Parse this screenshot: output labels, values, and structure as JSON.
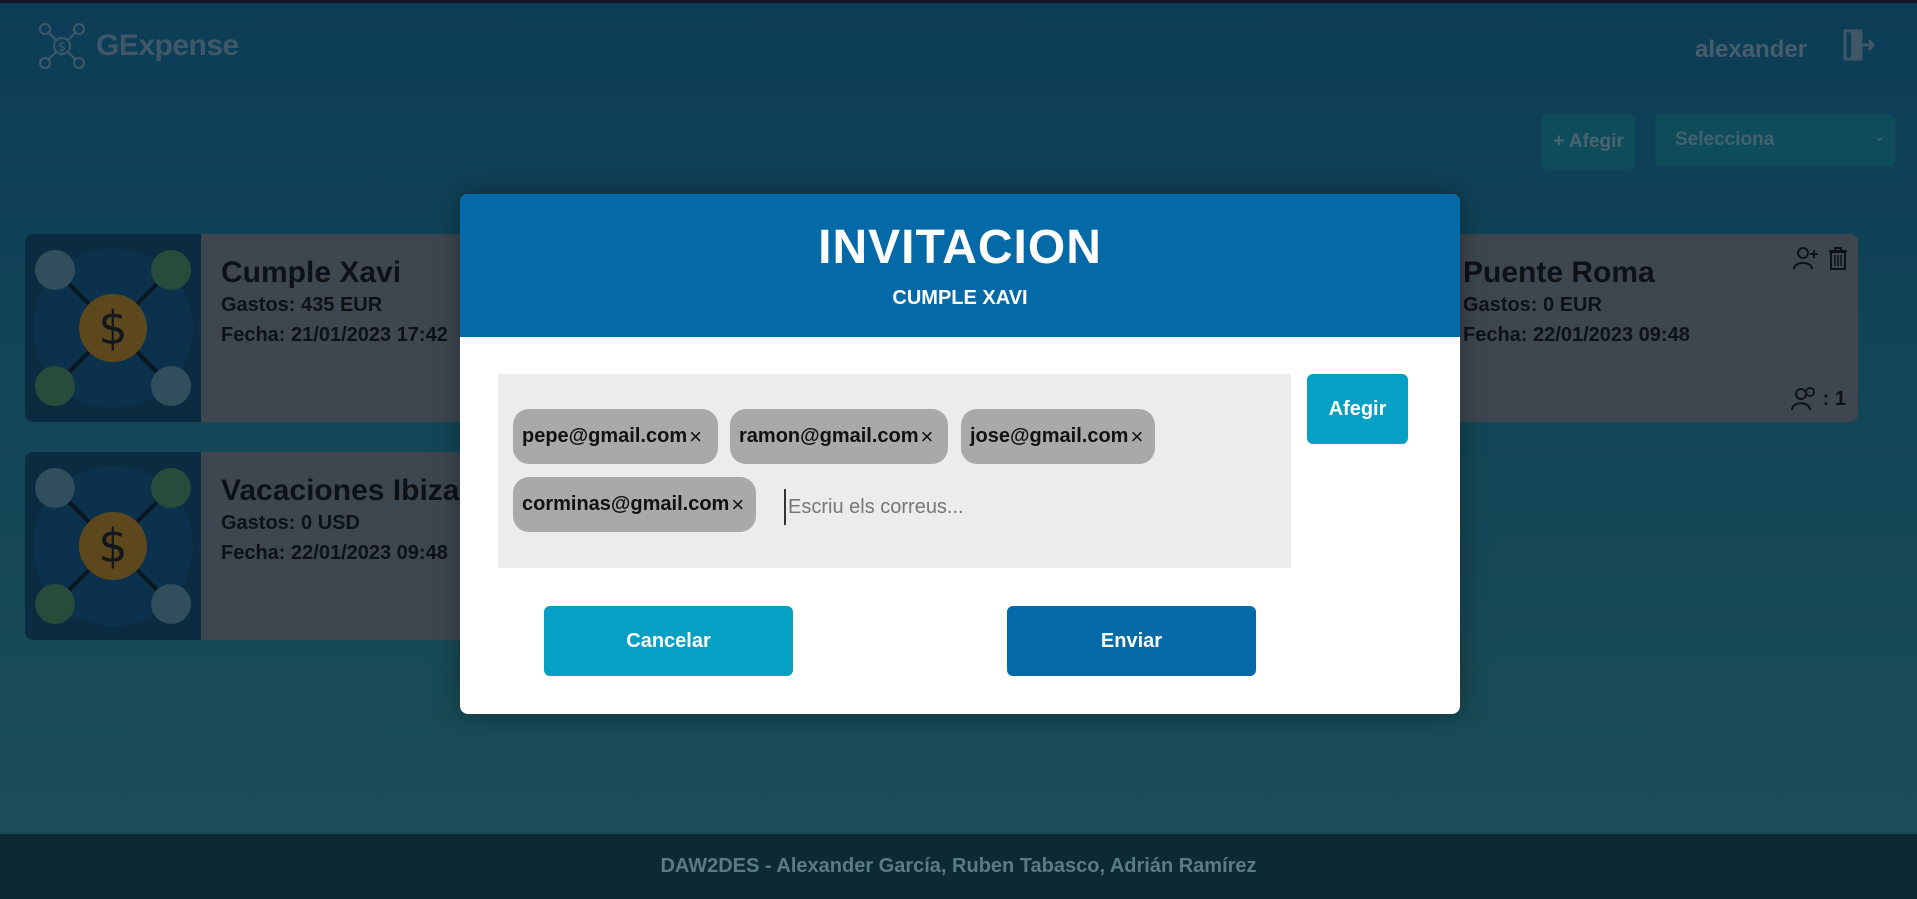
{
  "header": {
    "app_name": "GExpense",
    "username": "alexander"
  },
  "toolbar": {
    "add_label": "+ Afegir",
    "select_value": "Selecciona"
  },
  "groups": [
    {
      "title": "Cumple Xavi",
      "gastos": "Gastos: 435 EUR",
      "fecha": "Fecha: 21/01/2023 17:42"
    },
    {
      "title": "Puente Roma",
      "gastos": "Gastos: 0 EUR",
      "fecha": "Fecha: 22/01/2023 09:48",
      "members": ": 1"
    },
    {
      "title": "Vacaciones Ibiza",
      "gastos": "Gastos: 0 USD",
      "fecha": "Fecha: 22/01/2023 09:48"
    }
  ],
  "modal": {
    "title": "INVITACION",
    "subtitle": "CUMPLE XAVI",
    "emails": [
      "pepe@gmail.com",
      "ramon@gmail.com",
      "jose@gmail.com",
      "corminas@gmail.com"
    ],
    "input_placeholder": "Escriu els correus...",
    "add_label": "Afegir",
    "cancel_label": "Cancelar",
    "send_label": "Enviar"
  },
  "footer": {
    "credits": "DAW2DES - Alexander García, Ruben Tabasco, Adrián Ramírez"
  },
  "colors": {
    "primary": "#036aa7",
    "accent": "#06a0c4",
    "chip": "#a9a9a9"
  }
}
